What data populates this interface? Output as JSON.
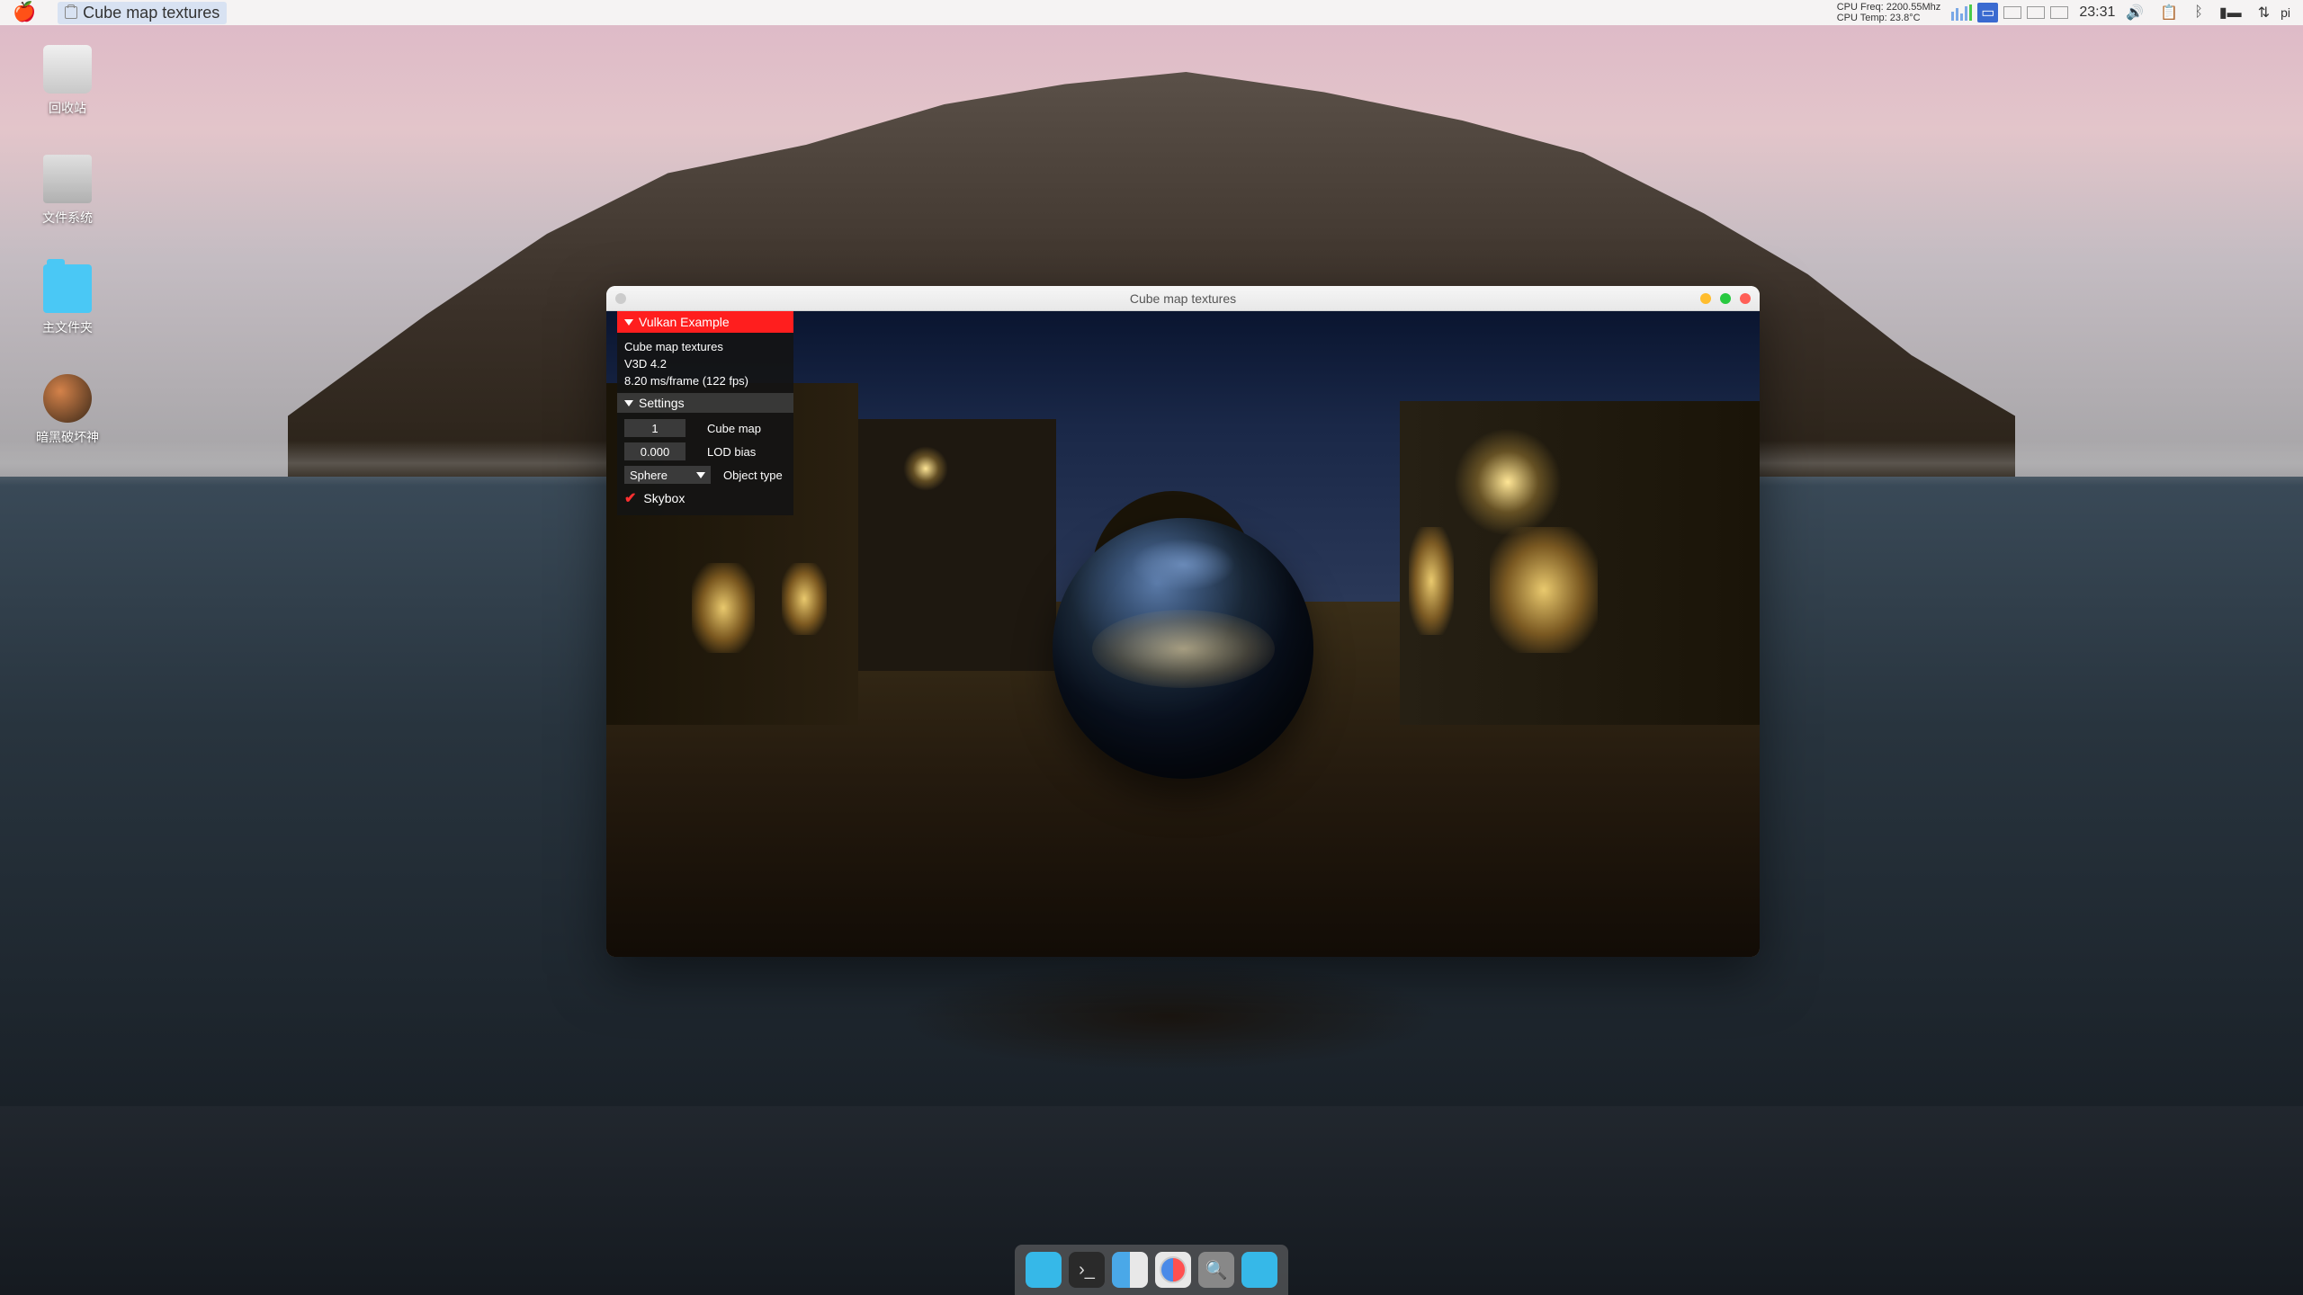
{
  "menubar": {
    "app_title": "Cube map textures",
    "cpu_freq_label": "CPU Freq: 2200.55Mhz",
    "cpu_temp_label": "CPU Temp: 23.8°C",
    "clock": "23:31",
    "user": "pi"
  },
  "desktop_icons": {
    "trash": "回收站",
    "disk": "文件系统",
    "home": "主文件夹",
    "game": "暗黑破坏神"
  },
  "window": {
    "title": "Cube map textures"
  },
  "imgui": {
    "header": "Vulkan Example",
    "line1": "Cube map textures",
    "line2": "V3D 4.2",
    "line3": "8.20 ms/frame (122 fps)",
    "settings_label": "Settings",
    "cubemap_value": "1",
    "cubemap_label": "Cube map",
    "lod_value": "0.000",
    "lod_label": "LOD bias",
    "object_value": "Sphere",
    "object_label": "Object type",
    "skybox_label": "Skybox"
  }
}
